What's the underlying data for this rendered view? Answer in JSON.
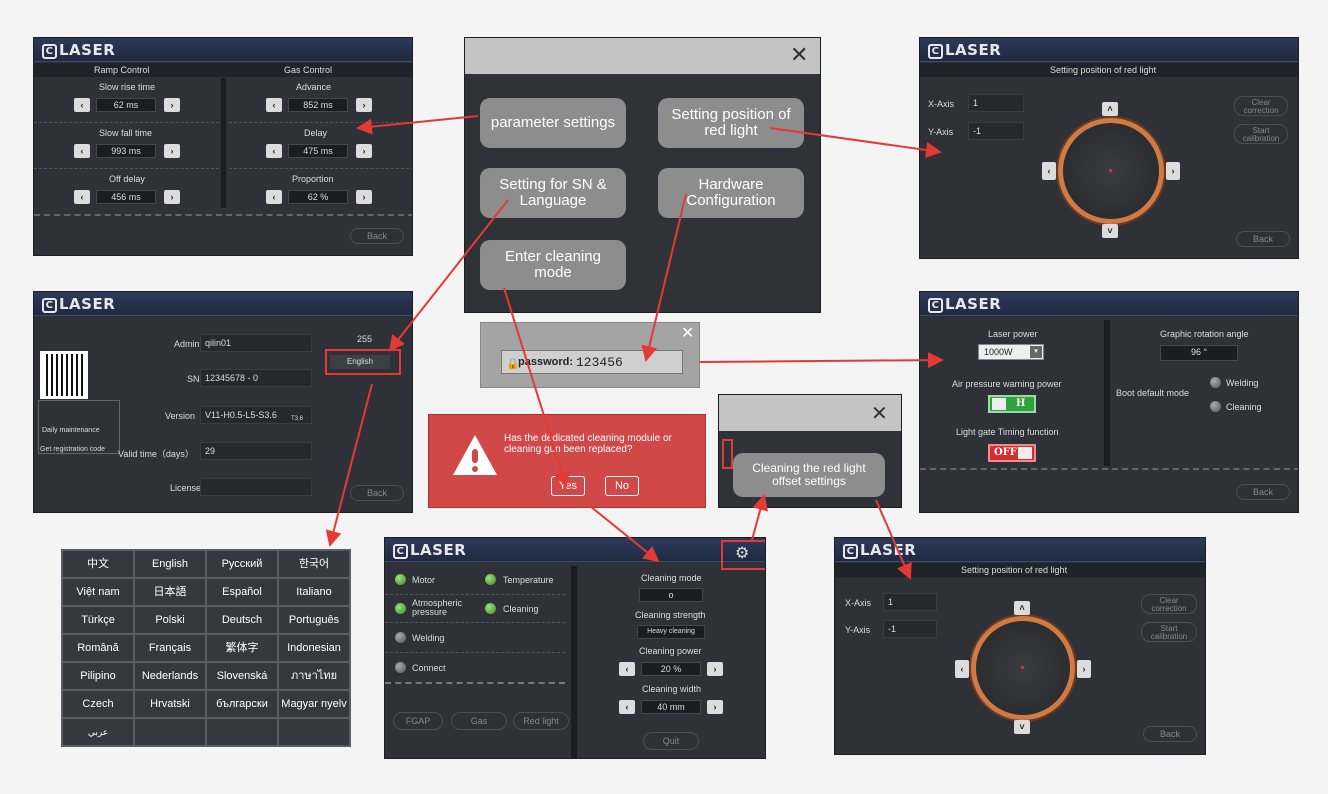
{
  "logo_text": "LASER",
  "colors": {
    "accent_red": "#e53935",
    "ring_orange": "#d07a45",
    "screen_bg": "#2e3137",
    "status_green": "#3c8a1f"
  },
  "s1": {
    "ramp_title": "Ramp Control",
    "gas_title": "Gas Control",
    "slow_rise_label": "Slow rise time",
    "slow_rise_value": "62 ms",
    "slow_fall_label": "Slow fall time",
    "slow_fall_value": "993 ms",
    "off_delay_label": "Off delay",
    "off_delay_value": "456 ms",
    "advance_label": "Advance",
    "advance_value": "852 ms",
    "delay_label": "Delay",
    "delay_value": "475 ms",
    "proportion_label": "Proportion",
    "proportion_value": "62 %",
    "back": "Back"
  },
  "menu": {
    "parameter_settings": "parameter settings",
    "red_light_position": "Setting position of red light",
    "sn_language": "Setting for SN & Language",
    "hardware_config": "Hardware Configuration",
    "cleaning_mode": "Enter cleaning mode",
    "close": "✕"
  },
  "s3": {
    "title": "Setting position of red light",
    "x_label": "X-Axis",
    "x_value": "1",
    "y_label": "Y-Axis",
    "y_value": "-1",
    "clear_correction": "Clear correction",
    "start_calibration": "Start calibration",
    "back": "Back"
  },
  "s4": {
    "admin_label": "Admin",
    "admin_value": "qilin01",
    "sn_label": "SN",
    "sn_value": "12345678 - 0",
    "version_label": "Version",
    "version_value": "V11-H0.5-L5-S3.6",
    "version_suffix": "T3.6",
    "valid_label": "Valid time（days）",
    "valid_value": "29",
    "license_label": "License",
    "license_value": "",
    "count": "255",
    "language": "English",
    "daily_maintenance": "Daily maintenance",
    "get_registration": "Get registration code",
    "back": "Back"
  },
  "password": {
    "label": "password:",
    "value": "123456",
    "close": "✕"
  },
  "s5": {
    "laser_power_label": "Laser power",
    "laser_power_value": "1000W",
    "air_pressure_label": "Air pressure warning power",
    "air_pressure_toggle": "H",
    "light_gate_label": "Light gate Timing function",
    "light_gate_toggle": "OFF",
    "graphic_rotation_label": "Graphic rotation angle",
    "graphic_rotation_value": "96 °",
    "boot_mode_label": "Boot default mode",
    "welding": "Welding",
    "cleaning": "Cleaning",
    "back": "Back"
  },
  "alert": {
    "message": "Has the dedicated cleaning module or cleaning gun been replaced?",
    "yes": "Yes",
    "no": "No"
  },
  "offset": {
    "button": "Cleaning the red light offset settings",
    "close": "✕"
  },
  "languages": [
    [
      "中文",
      "English",
      "Русский",
      "한국어"
    ],
    [
      "Việt nam",
      "日本語",
      "Español",
      "Italiano"
    ],
    [
      "Türkçe",
      "Polski",
      "Deutsch",
      "Português"
    ],
    [
      "Română",
      "Français",
      "繁体字",
      "Indonesian"
    ],
    [
      "Pilipino",
      "Nederlands",
      "Slovenská",
      "ภาษาไทย"
    ],
    [
      "Czech",
      "Hrvatski",
      "български",
      "Magyar nyelv"
    ],
    [
      "عربي",
      "",
      "",
      ""
    ]
  ],
  "s6": {
    "motor": "Motor",
    "temperature": "Temperature",
    "atmospheric": "Atmospheric pressure",
    "cleaning": "Cleaning",
    "welding": "Welding",
    "connect": "Connect",
    "cleaning_mode_label": "Cleaning mode",
    "cleaning_mode_value": "o",
    "cleaning_strength_label": "Cleaning strength",
    "cleaning_strength_value": "Heavy cleaning",
    "cleaning_power_label": "Cleaning power",
    "cleaning_power_value": "20 %",
    "cleaning_width_label": "Cleaning width",
    "cleaning_width_value": "40 mm",
    "fgap": "FGAP",
    "gas": "Gas",
    "red_light": "Red light",
    "quit": "Quit"
  },
  "s7": {
    "title": "Setting position of red light",
    "x_label": "X-Axis",
    "x_value": "1",
    "y_label": "Y-Axis",
    "y_value": "-1",
    "clear_correction": "Clear correction",
    "start_calibration": "Start calibration",
    "back": "Back"
  }
}
